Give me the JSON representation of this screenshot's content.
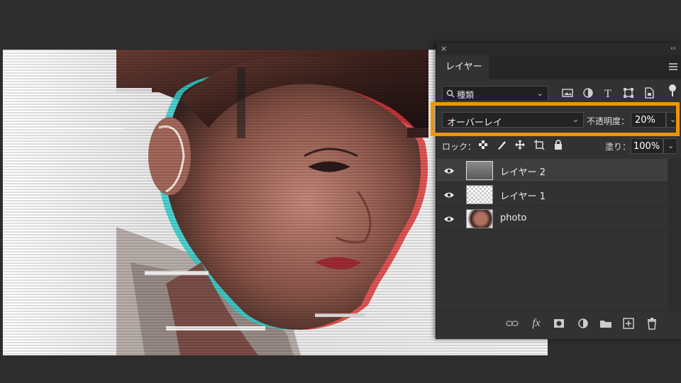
{
  "panel": {
    "close_glyph": "×",
    "collapse_glyph": "‹‹",
    "tab_label": "レイヤー",
    "filter": {
      "label": "種類",
      "icons": [
        "image-filter-icon",
        "adjustment-filter-icon",
        "type-filter-icon",
        "shape-filter-icon",
        "smart-object-filter-icon",
        "filter-toggle-icon"
      ]
    },
    "blend_mode": "オーバーレイ",
    "opacity_label": "不透明度：",
    "opacity_value": "20%",
    "lock_label": "ロック：",
    "fill_label": "塗り：",
    "fill_value": "100%",
    "layers": [
      {
        "name": "レイヤー 2",
        "selected": true,
        "thumb": "gray-gradient"
      },
      {
        "name": "レイヤー 1",
        "selected": false,
        "thumb": "transparent"
      },
      {
        "name": "photo",
        "selected": false,
        "thumb": "portrait"
      }
    ],
    "bottom_icons": [
      "link-layers-icon",
      "fx-icon",
      "add-mask-icon",
      "adjustment-layer-icon",
      "new-group-icon",
      "new-layer-icon",
      "delete-layer-icon"
    ],
    "fx_label": "fx"
  },
  "colors": {
    "highlight": "#f29400",
    "panel_bg": "#323232",
    "canvas_bg": "#2d2d2d"
  }
}
